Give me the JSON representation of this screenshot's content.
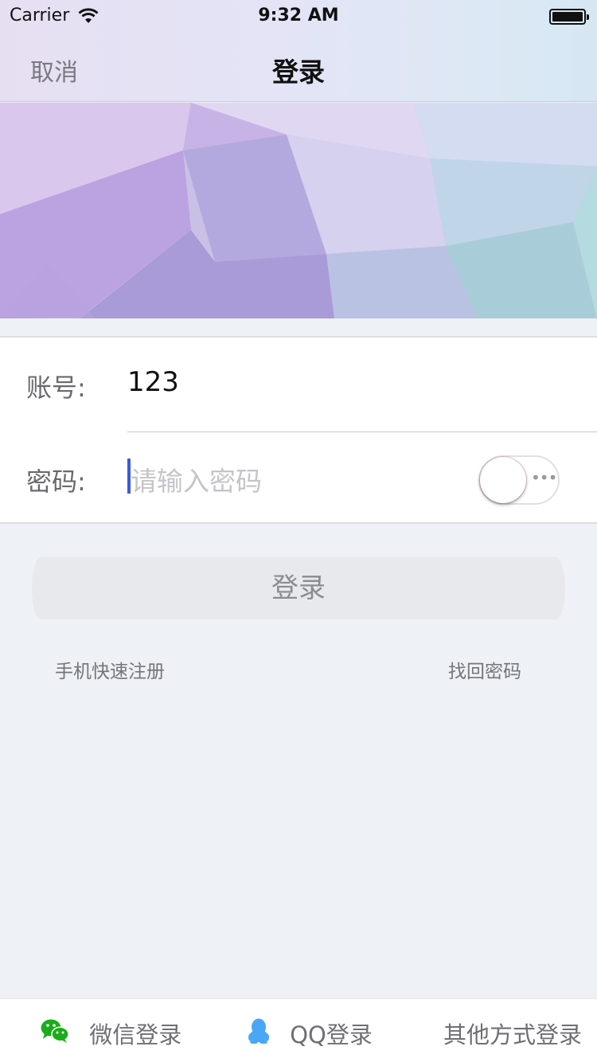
{
  "status_bar": {
    "carrier": "Carrier",
    "time": "9:32 AM"
  },
  "nav": {
    "cancel_label": "取消",
    "title": "登录"
  },
  "form": {
    "account_label": "账号:",
    "account_value": "123",
    "password_label": "密码:",
    "password_placeholder": "请输入密码"
  },
  "actions": {
    "login_label": "登录",
    "register_label": "手机快速注册",
    "forgot_label": "找回密码"
  },
  "bottom_bar": {
    "wechat_label": "微信登录",
    "qq_label": "QQ登录",
    "other_label": "其他方式登录"
  },
  "colors": {
    "accent_caret": "#3b5bdb",
    "wechat_green": "#1aad19",
    "qq_blue": "#4aa7f5"
  },
  "icons": [
    "wifi-icon",
    "battery-icon",
    "wechat-icon",
    "qq-icon"
  ]
}
